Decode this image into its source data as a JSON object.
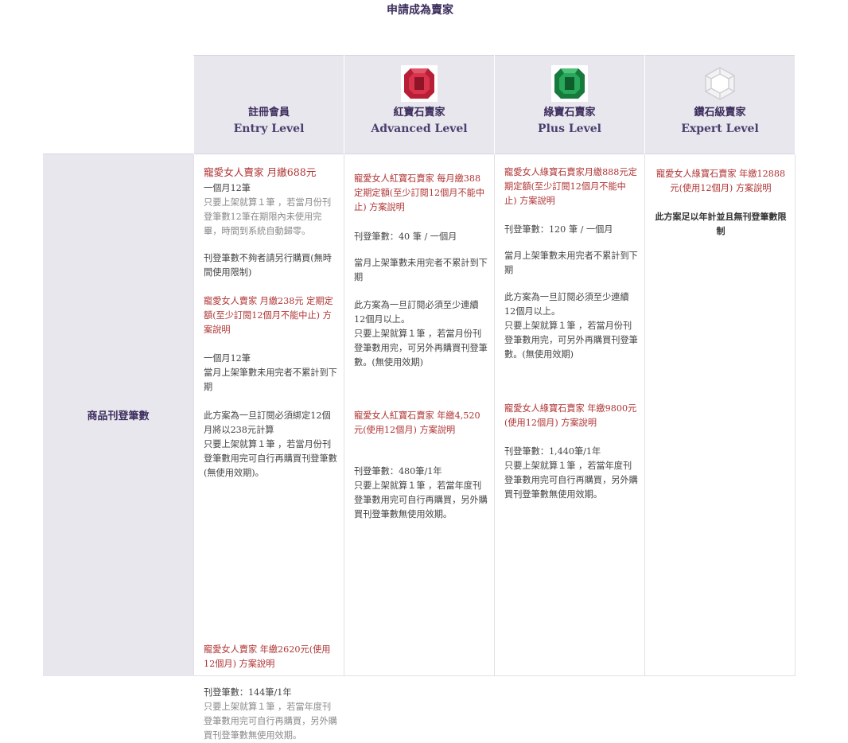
{
  "page": {
    "title": "申請成為賣家"
  },
  "plans": [
    {
      "zh": "註冊會員",
      "en": "Entry Level",
      "icon": "none"
    },
    {
      "zh": "紅寶石賣家",
      "en": "Advanced Level",
      "icon": "ruby-icon",
      "color": "#c4243c"
    },
    {
      "zh": "綠寶石賣家",
      "en": "Plus Level",
      "icon": "emerald-icon",
      "color": "#1f9a4e"
    },
    {
      "zh": "鑽石級賣家",
      "en": "Expert Level",
      "icon": "diamond-icon",
      "color": "#d9d9d9"
    }
  ],
  "row_label": "商品刊登筆數",
  "entry": {
    "b1_title": "寵愛女人賣家 月繳688元",
    "b1_l1": "一個月12筆",
    "b1_l2": "只要上架就算１筆 ，若當月份刊登筆數12筆在期限內未使用完畢，時間到系統自動歸零。",
    "b2": "刊登筆數不夠者請另行購買(無時間使用限制)",
    "b3_title": "寵愛女人賣家 月繳238元 定期定額(至少訂閱12個月不能中止) 方案說明",
    "b4": "一個月12筆\n當月上架筆數未用完者不累計到下期",
    "b5": "此方案為一旦訂閱必須綁定12個月將以238元計算\n只要上架就算１筆 ，若當月份刊登筆數用完可自行再購買刊登筆數(無使用效期)。",
    "b6_title": "寵愛女人賣家 年繳2620元(使用12個月) 方案說明",
    "b7_l1": "刊登筆數：144筆/1年",
    "b7_l2": "只要上架就算１筆 ，若當年度刊登筆數用完可自行再購買，另外購買刊登筆數無使用效期。"
  },
  "ruby": {
    "b1_title": "寵愛女人紅寶石賣家 每月繳388 定期定額(至少訂閱12個月不能中止) 方案說明",
    "b2": "刊登筆數：40 筆 / 一個月",
    "b3": "當月上架筆數未用完者不累計到下期",
    "b4": "此方案為一旦訂閱必須至少連續12個月以上。\n只要上架就算１筆 ，若當月份刊登筆數用完，可另外再購買刊登筆數。(無使用效期)",
    "b5_title": "寵愛女人紅寶石賣家 年繳4,520元(使用12個月) 方案說明",
    "b6": "刊登筆數：480筆/1年\n只要上架就算１筆 ，若當年度刊登筆數用完可自行再購買，另外購買刊登筆數無使用效期。"
  },
  "emerald": {
    "b1_title": "寵愛女人綠寶石賣家月繳888元定期定額(至少訂閱12個月不能中止) 方案說明",
    "b2": "刊登筆數：120 筆 / 一個月",
    "b3": "當月上架筆數未用完者不累計到下期",
    "b4": "此方案為一旦訂閱必須至少連續12個月以上。\n只要上架就算１筆 ，若當月份刊登筆數用完，可另外再購買刊登筆數。(無使用效期)",
    "b5_title": "寵愛女人綠寶石賣家 年繳9800元(使用12個月) 方案說明",
    "b6": "刊登筆數：1,440筆/1年\n只要上架就算１筆 ，若當年度刊登筆數用完可自行再購買，另外購買刊登筆數無使用效期。"
  },
  "diamond": {
    "b1_title": "寵愛女人綠寶石賣家 年繳12888元(使用12個月) 方案說明",
    "b2": "此方案足以年計並且無刊登筆數限制"
  }
}
